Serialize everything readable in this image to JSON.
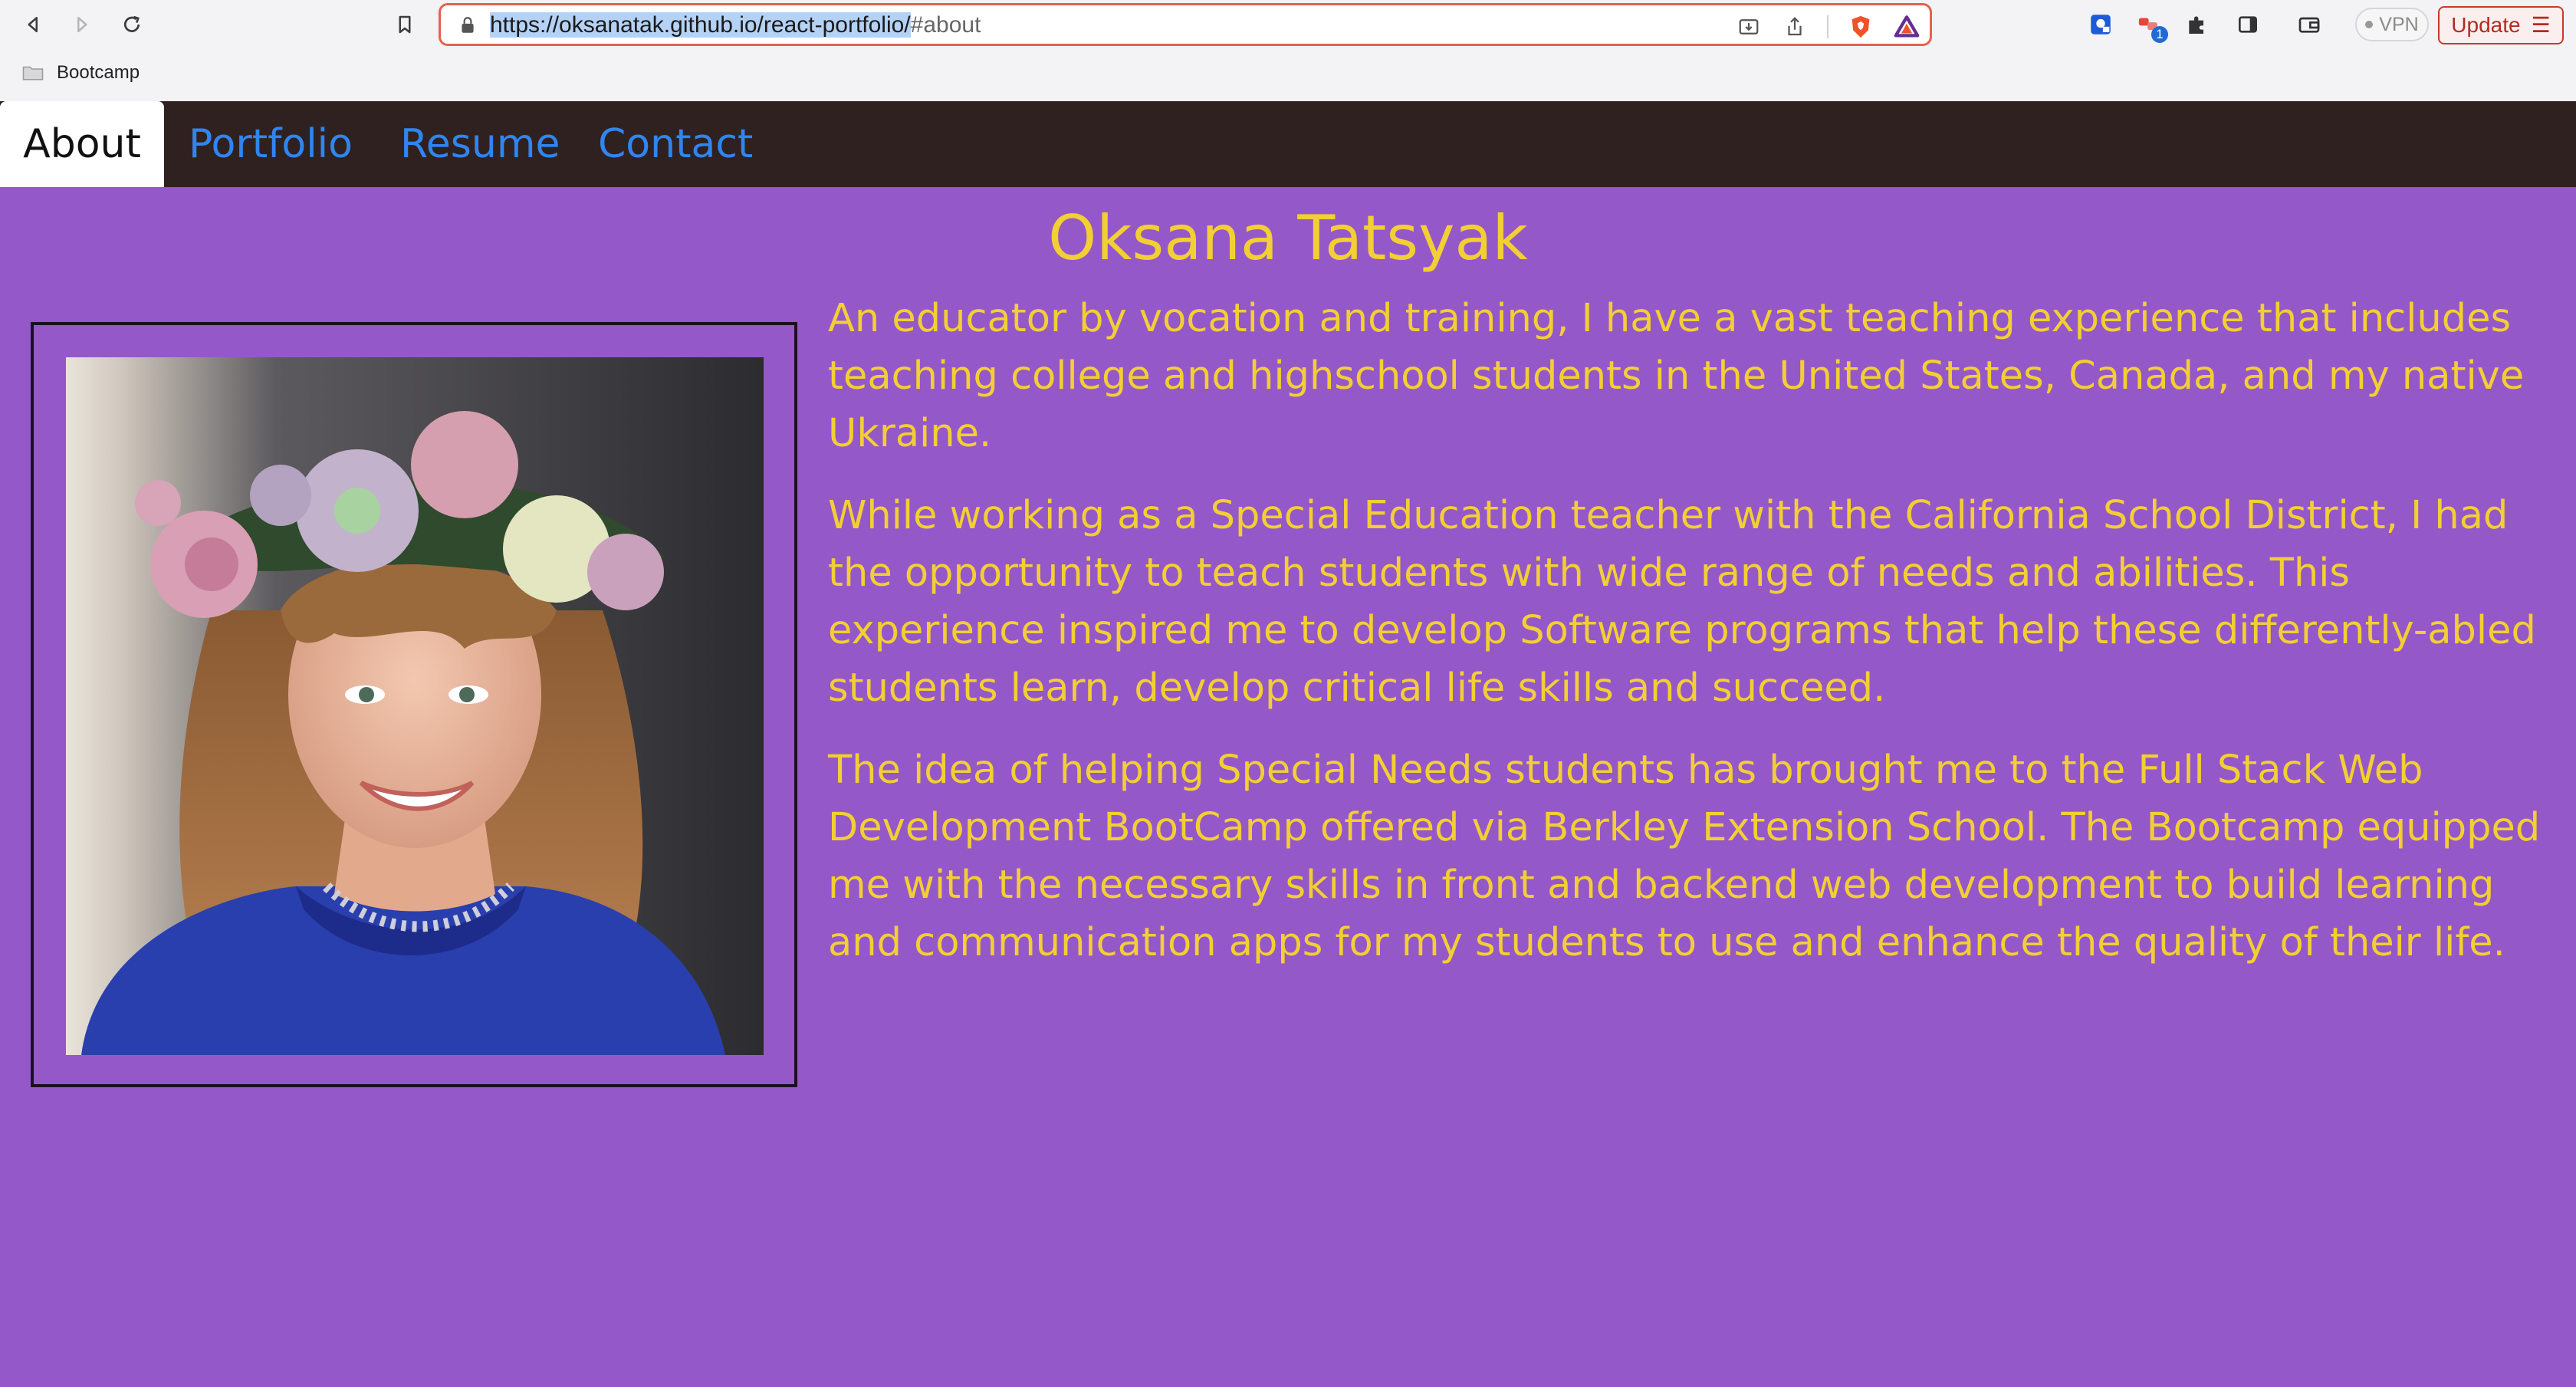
{
  "browser": {
    "url_selected": "https://oksanatak.github.io/react-portfolio/",
    "url_rest": "#about",
    "vpn_label": "VPN",
    "update_label": "Update",
    "extension_badge": "1",
    "bookmarks": [
      {
        "label": "Bootcamp"
      }
    ],
    "icons": {
      "back": "back-arrow-icon",
      "forward": "forward-arrow-icon",
      "reload": "reload-icon",
      "bookmark": "bookmark-icon",
      "lock": "lock-icon",
      "install": "install-app-icon",
      "share": "share-icon",
      "brave_shield": "brave-shield-icon",
      "brave_rewards": "brave-rewards-icon"
    }
  },
  "nav": {
    "tabs": [
      {
        "label": "About",
        "active": true
      },
      {
        "label": "Portfolio",
        "active": false
      },
      {
        "label": "Resume",
        "active": false
      },
      {
        "label": "Contact",
        "active": false
      }
    ]
  },
  "about": {
    "name": "Oksana Tatsyak",
    "paragraphs": [
      "An educator by vocation and training, I have a vast teaching experience that includes teaching college and highschool students in the United States, Canada, and my native Ukraine.",
      "While working as a Special Education teacher with the California School District, I had the opportunity to teach students with wide range of needs and abilities. This experience inspired me to develop Software programs that help these differently-abled students learn, develop critical life skills and succeed.",
      "The idea of helping Special Needs students has brought me to the Full Stack Web Development BootCamp offered via Berkley Extension School. The Bootcamp equipped me with the necessary skills in front and backend web development to build learning and communication apps for my students to use and enhance the quality of their life."
    ]
  },
  "colors": {
    "page_background": "#9558c9",
    "nav_background": "#302121",
    "nav_link": "#2f86f0",
    "accent_text": "#f2cf33",
    "url_focus_border": "#e5614e"
  }
}
